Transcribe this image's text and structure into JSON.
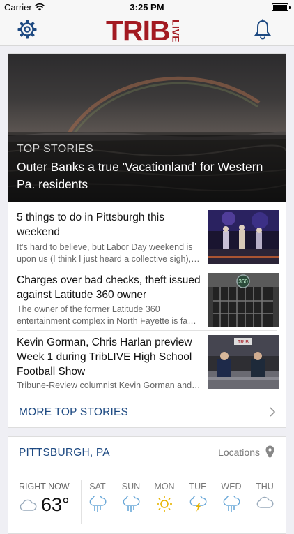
{
  "status_bar": {
    "carrier": "Carrier",
    "time": "3:25 PM"
  },
  "nav": {
    "logo_main": "TRIB",
    "logo_sub": "LIVE"
  },
  "hero": {
    "kicker": "TOP STORIES",
    "headline": "Outer Banks a true 'Vacationland' for Western Pa. residents"
  },
  "stories": [
    {
      "title": "5 things to do in Pittsburgh this weekend",
      "summary": "It's hard to believe, but Labor Day weekend is upon us (I think I just heard a collective sigh),…"
    },
    {
      "title": "Charges over bad checks, theft issued against Latitude 360 owner",
      "summary": "The owner of the former Latitude 360 entertainment complex in North Fayette is fa…"
    },
    {
      "title": "Kevin Gorman, Chris Harlan preview Week 1 during TribLIVE High School Football Show",
      "summary": "Tribune-Review columnist Kevin Gorman and…"
    }
  ],
  "more_top_stories": "MORE TOP STORIES",
  "weather": {
    "city": "PITTSBURGH, PA",
    "locations_label": "Locations",
    "right_now_label": "RIGHT NOW",
    "right_now_temp": "63°",
    "right_now_icon": "cloud-icon",
    "days": [
      {
        "name": "SAT",
        "icon": "rain-icon"
      },
      {
        "name": "SUN",
        "icon": "rain-icon"
      },
      {
        "name": "MON",
        "icon": "sun-icon"
      },
      {
        "name": "TUE",
        "icon": "thunderstorm-icon"
      },
      {
        "name": "WED",
        "icon": "rain-icon"
      },
      {
        "name": "THU",
        "icon": "cloud-icon"
      }
    ]
  },
  "colors": {
    "brand_red": "#a31a22",
    "link_blue": "#1e4a82",
    "icon_blue": "#1e4a82",
    "sun_yellow": "#e8b400",
    "weather_icon_blue": "#6aa8d8"
  }
}
